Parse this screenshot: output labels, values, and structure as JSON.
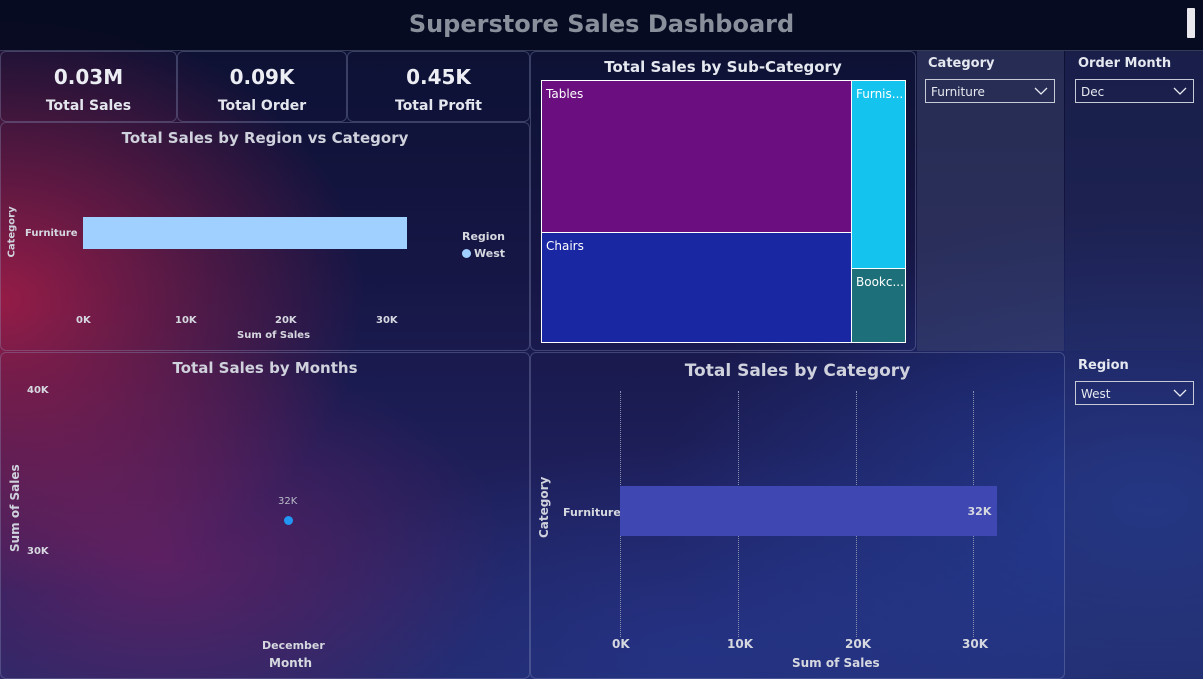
{
  "header": {
    "title": "Superstore Sales Dashboard"
  },
  "kpis": [
    {
      "value": "0.03M",
      "label": "Total Sales"
    },
    {
      "value": "0.09K",
      "label": "Total Order"
    },
    {
      "value": "0.45K",
      "label": "Total Profit"
    }
  ],
  "region_chart": {
    "title": "Total Sales by Region vs Category",
    "ylabel": "Category",
    "xlabel": "Sum of Sales",
    "category": "Furniture",
    "ticks": [
      "0K",
      "10K",
      "20K",
      "30K"
    ],
    "legend_title": "Region",
    "legend_item": "West",
    "color": "#9fd0ff"
  },
  "treemap": {
    "title": "Total Sales by Sub-Category",
    "tiles": [
      {
        "label": "Tables",
        "color": "#6b0f80"
      },
      {
        "label": "Chairs",
        "color": "#1a27a3"
      },
      {
        "label": "Furnis...",
        "color": "#15c4ee"
      },
      {
        "label": "Bookc...",
        "color": "#1d7079"
      }
    ]
  },
  "months_chart": {
    "title": "Total Sales by Months",
    "ylabel": "Sum of Sales",
    "xlabel": "Month",
    "y_ticks": [
      "40K",
      "30K"
    ],
    "x_category": "December",
    "point_label": "32K",
    "color": "#2196f3"
  },
  "category_chart": {
    "title": "Total Sales by Category",
    "ylabel": "Category",
    "xlabel": "Sum of Sales",
    "category": "Furniture",
    "value_label": "32K",
    "ticks": [
      "0K",
      "10K",
      "20K",
      "30K"
    ],
    "color": "#3f48b2"
  },
  "slicers": {
    "category": {
      "title": "Category",
      "value": "Furniture"
    },
    "order_month": {
      "title": "Order Month",
      "value": "Dec"
    },
    "region": {
      "title": "Region",
      "value": "West"
    }
  },
  "chart_data": [
    {
      "type": "bar",
      "title": "Total Sales by Region vs Category",
      "xlabel": "Sum of Sales",
      "ylabel": "Category",
      "categories": [
        "Furniture"
      ],
      "series": [
        {
          "name": "West",
          "values": [
            32000
          ]
        }
      ],
      "xlim": [
        0,
        30000
      ],
      "legend": "right"
    },
    {
      "type": "line",
      "title": "Total Sales by Months",
      "xlabel": "Month",
      "ylabel": "Sum of Sales",
      "categories": [
        "December"
      ],
      "values": [
        32000
      ],
      "ylim": [
        30000,
        40000
      ]
    },
    {
      "type": "bar",
      "title": "Total Sales by Category",
      "xlabel": "Sum of Sales",
      "ylabel": "Category",
      "categories": [
        "Furniture"
      ],
      "values": [
        32000
      ],
      "xlim": [
        0,
        30000
      ],
      "grid": true
    },
    {
      "type": "treemap",
      "title": "Total Sales by Sub-Category",
      "categories": [
        "Tables",
        "Chairs",
        "Furnis...",
        "Bookc..."
      ],
      "values": [
        14400,
        11600,
        4300,
        1800
      ]
    }
  ]
}
